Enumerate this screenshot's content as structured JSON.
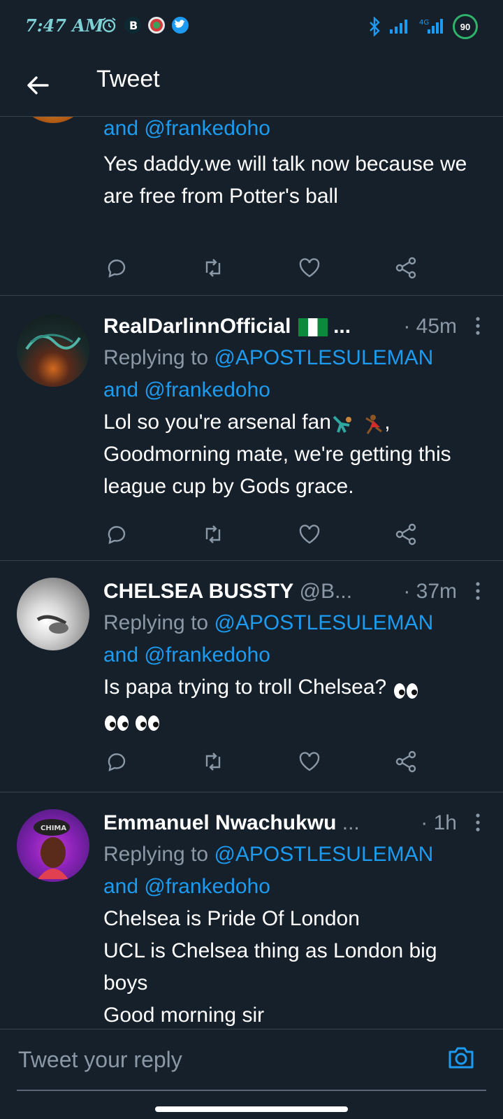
{
  "status_bar": {
    "time": "7:47 AM",
    "battery": "90",
    "network": "4G"
  },
  "header": {
    "title": "Tweet"
  },
  "tweets": [
    {
      "name": "",
      "handle": "",
      "time": "",
      "replying_prefix": "",
      "mention_a": "",
      "mention_and": "and",
      "mention_b": "@frankedoho",
      "body": "Yes daddy.we will talk now because we are free from Potter's ball"
    },
    {
      "name": "RealDarlinnOfficial",
      "name_suffix": "...",
      "handle": "",
      "time": "· 45m",
      "replying_prefix": "Replying to",
      "mention_a": "@APOSTLESULEMAN",
      "mention_and": "and",
      "mention_b": "@frankedoho",
      "body_line1": "Lol so you're arsenal fan",
      "body_line1_end": ",",
      "body_rest": "Goodmorning mate, we're getting this league cup by Gods grace."
    },
    {
      "name": "CHELSEA BUSSTY",
      "handle": "@B...",
      "time": "· 37m",
      "replying_prefix": "Replying to",
      "mention_a": "@APOSTLESULEMAN",
      "mention_and": "and",
      "mention_b": "@frankedoho",
      "body": "Is papa trying to troll Chelsea?"
    },
    {
      "name": "Emmanuel Nwachukwu",
      "name_suffix": "...",
      "handle": "",
      "time": "· 1h",
      "replying_prefix": "Replying to",
      "mention_a": "@APOSTLESULEMAN",
      "mention_and": "and",
      "mention_b": "@frankedoho",
      "body_l1": "Chelsea is Pride Of London",
      "body_l2": "UCL is Chelsea thing as London big boys",
      "body_l3": "Good morning sir"
    }
  ],
  "composer": {
    "placeholder": "Tweet your reply"
  },
  "colors": {
    "background": "#15202b",
    "accent": "#1d9bf0",
    "muted": "#8b98a5",
    "divider": "#38444d"
  },
  "icons": [
    "back-arrow-icon",
    "reply-icon",
    "retweet-icon",
    "like-icon",
    "share-icon",
    "camera-icon",
    "more-icon"
  ]
}
